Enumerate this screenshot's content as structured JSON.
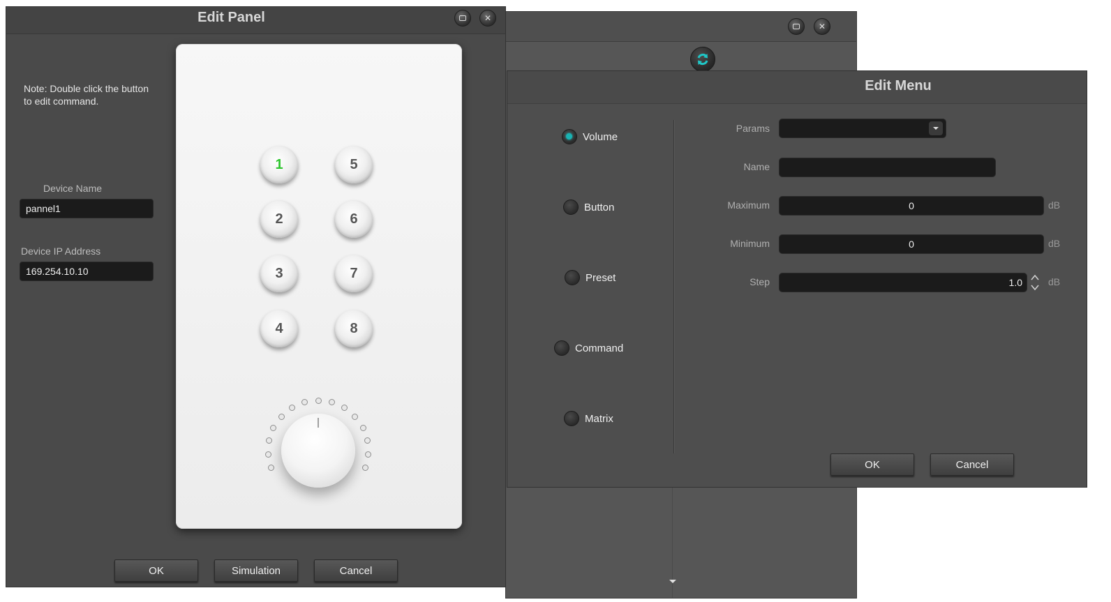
{
  "edit_panel": {
    "title": "Edit Panel",
    "note": "Note: Double click the button to edit command.",
    "device_name_label": "Device Name",
    "device_name_value": "pannel1",
    "device_ip_label": "Device IP Address",
    "device_ip_value": "169.254.10.10",
    "buttons": [
      "1",
      "2",
      "3",
      "4",
      "5",
      "6",
      "7",
      "8"
    ],
    "active_button": "1",
    "knob_led_count": 15,
    "ok_label": "OK",
    "simulation_label": "Simulation",
    "cancel_label": "Cancel"
  },
  "edit_menu": {
    "title": "Edit Menu",
    "types": [
      "Volume",
      "Button",
      "Preset",
      "Command",
      "Matrix"
    ],
    "selected_type": "Volume",
    "params_label": "Params",
    "params_value": "",
    "name_label": "Name",
    "name_value": "",
    "maximum_label": "Maximum",
    "maximum_value": "0",
    "minimum_label": "Minimum",
    "minimum_value": "0",
    "step_label": "Step",
    "step_value": "1.0",
    "unit": "dB",
    "ok_label": "OK",
    "cancel_label": "Cancel"
  },
  "colors": {
    "accent": "#19b3b3",
    "active_button_text": "#2ec52e"
  }
}
